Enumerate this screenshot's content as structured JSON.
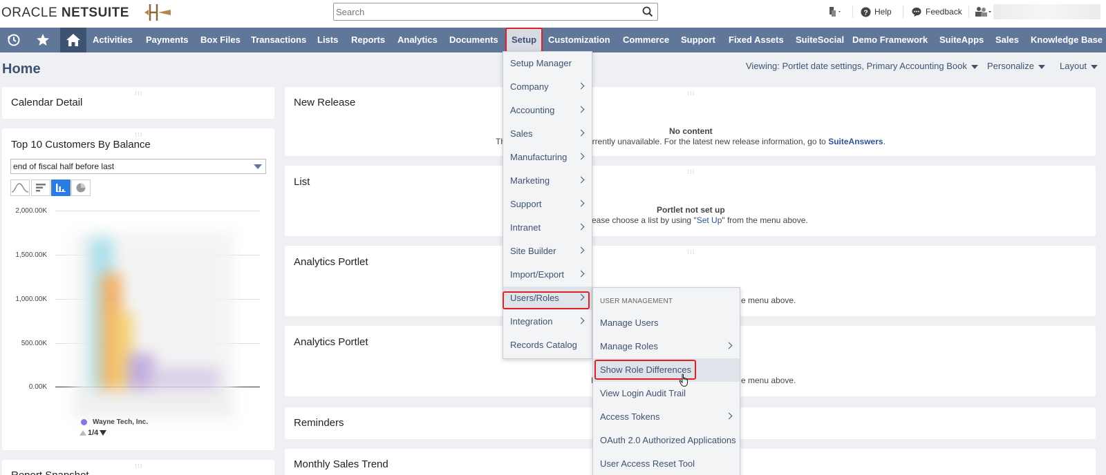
{
  "header": {
    "logo_oracle": "ORACLE",
    "logo_netsuite": "NETSUITE",
    "search_placeholder": "Search",
    "help_label": "Help",
    "feedback_label": "Feedback"
  },
  "nav": {
    "items": [
      "Activities",
      "Payments",
      "Box Files",
      "Transactions",
      "Lists",
      "Reports",
      "Analytics",
      "Documents",
      "Setup",
      "Customization",
      "Commerce",
      "Support",
      "Fixed Assets",
      "SuiteSocial",
      "Demo Framework",
      "SuiteApps",
      "Sales",
      "Knowledge Base"
    ]
  },
  "page": {
    "title": "Home",
    "viewing": "Viewing: Portlet date settings, Primary Accounting Book",
    "personalize": "Personalize",
    "layout": "Layout"
  },
  "portlets": {
    "calendar": "Calendar Detail",
    "top_customers": {
      "title": "Top 10 Customers By Balance",
      "period": "end of fiscal half before last",
      "legend_item": "Wayne Tech, Inc.",
      "pager": "1/4"
    },
    "report_snapshot": "Report Snapshot",
    "new_release": {
      "title": "New Release",
      "empty_title": "No content",
      "empty_text_prefix": "Th",
      "empty_text_suffix": "currently unavailable. For the latest new release information, go to",
      "empty_link": "SuiteAnswers",
      "empty_end": "."
    },
    "list": {
      "title": "List",
      "empty_title": "Portlet not set up",
      "empty_text": "ease choose a list by using \"",
      "empty_link": "Set Up",
      "empty_end": "\" from the menu above."
    },
    "analytics1": {
      "title": "Analytics Portlet",
      "empty_text": "e menu above."
    },
    "analytics2": {
      "title": "Analytics Portlet",
      "empty_prefix": "P",
      "empty_text": "e menu above."
    },
    "reminders": "Reminders",
    "monthly_sales": "Monthly Sales Trend"
  },
  "chart_data": {
    "type": "bar",
    "title": "Top 10 Customers By Balance",
    "y_ticks": [
      "2,000.00K",
      "1,500.00K",
      "1,000.00K",
      "500.00K",
      "0.00K"
    ],
    "ylim": [
      0,
      2000
    ],
    "legend": [
      "Wayne Tech, Inc."
    ]
  },
  "setup_menu": {
    "items": [
      "Setup Manager",
      "Company",
      "Accounting",
      "Sales",
      "Manufacturing",
      "Marketing",
      "Support",
      "Intranet",
      "Site Builder",
      "Import/Export",
      "Users/Roles",
      "Integration",
      "Records Catalog"
    ]
  },
  "users_menu": {
    "header": "USER MANAGEMENT",
    "items": [
      "Manage Users",
      "Manage Roles",
      "Show Role Differences",
      "View Login Audit Trail",
      "Access Tokens",
      "OAuth 2.0 Authorized Applications",
      "User Access Reset Tool"
    ]
  },
  "colors": {
    "nav_bg": "#607799",
    "nav_home_bg": "#3e5272",
    "highlight": "#e01f27",
    "page_bg": "#eef0f4"
  }
}
